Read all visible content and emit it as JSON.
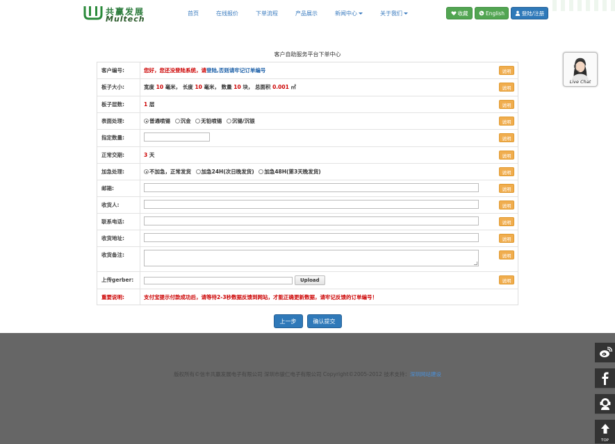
{
  "logo": {
    "cn": "共赢发展",
    "en": "Multech"
  },
  "nav": [
    {
      "label": "首页",
      "dropdown": false
    },
    {
      "label": "在线报价",
      "dropdown": false
    },
    {
      "label": "下单流程",
      "dropdown": false
    },
    {
      "label": "产品展示",
      "dropdown": false
    },
    {
      "label": "新闻中心",
      "dropdown": true
    },
    {
      "label": "关于我们",
      "dropdown": true
    }
  ],
  "header_buttons": {
    "favorites": "收藏",
    "english": "English",
    "login": "登陆/注册"
  },
  "page_title": "客户自助服务平台下单中心",
  "note_label": "说明",
  "rows": {
    "customer_no": {
      "label": "客户编号:",
      "greeting": "您好，您还没登陆系统，请",
      "login_link": "登陆",
      "after": ",否则请牢记订单编号"
    },
    "board_size": {
      "label": "板子大小:",
      "width_label": "宽度",
      "width": "10",
      "width_unit": "毫米，",
      "length_label": "长度",
      "length": "10",
      "length_unit": "毫米，",
      "qty_label": "数量",
      "qty": "10",
      "qty_unit": "块，",
      "area_label": "总面积",
      "area": "0.001",
      "area_unit": "㎡"
    },
    "layers": {
      "label": "板子层数:",
      "value": "1",
      "unit": "层"
    },
    "surface": {
      "label": "表面处理:",
      "options": [
        "普通喷锡",
        "沉金",
        "无铅喷锡",
        "沉锡/沉银"
      ],
      "selected": 0
    },
    "stencil_qty": {
      "label": "指定数量:",
      "value": ""
    },
    "lead_time": {
      "label": "正常交期:",
      "value": "3",
      "unit": "天"
    },
    "expedite": {
      "label": "加急处理:",
      "options": [
        "不加急，正常发货",
        "加急24H(次日晚发货)",
        "加急48H(第3天晚发货)"
      ],
      "selected": 0
    },
    "email": {
      "label": "邮箱:",
      "value": ""
    },
    "receiver": {
      "label": "收货人:",
      "value": ""
    },
    "phone": {
      "label": "联系电话:",
      "value": ""
    },
    "address": {
      "label": "收货地址:",
      "value": ""
    },
    "remark": {
      "label": "收货备注:",
      "value": ""
    },
    "gerber": {
      "label": "上传gerber:",
      "upload_label": "Upload"
    },
    "important": {
      "label": "重要说明:",
      "text": "支付宝提示付款成功后，请等待2-3秒数据反馈到网站，才能正确更新数据，请牢记反馈的订单编号！"
    }
  },
  "actions": {
    "prev": "上一步",
    "submit": "确认提交"
  },
  "footer": {
    "copyright": "版权所有©信丰共赢发展电子有限公司 深圳市骏仁电子有限公司 Copyright©2005-2012 技术支持：",
    "support_link": "深圳网站建设"
  },
  "live_chat": "Live Chat",
  "side_top": "TOP",
  "colors": {
    "accent_blue": "#2f79b9",
    "green": "#52a552",
    "orange": "#f0ad4e",
    "red": "#cc0000",
    "footer_bg": "#666666"
  }
}
